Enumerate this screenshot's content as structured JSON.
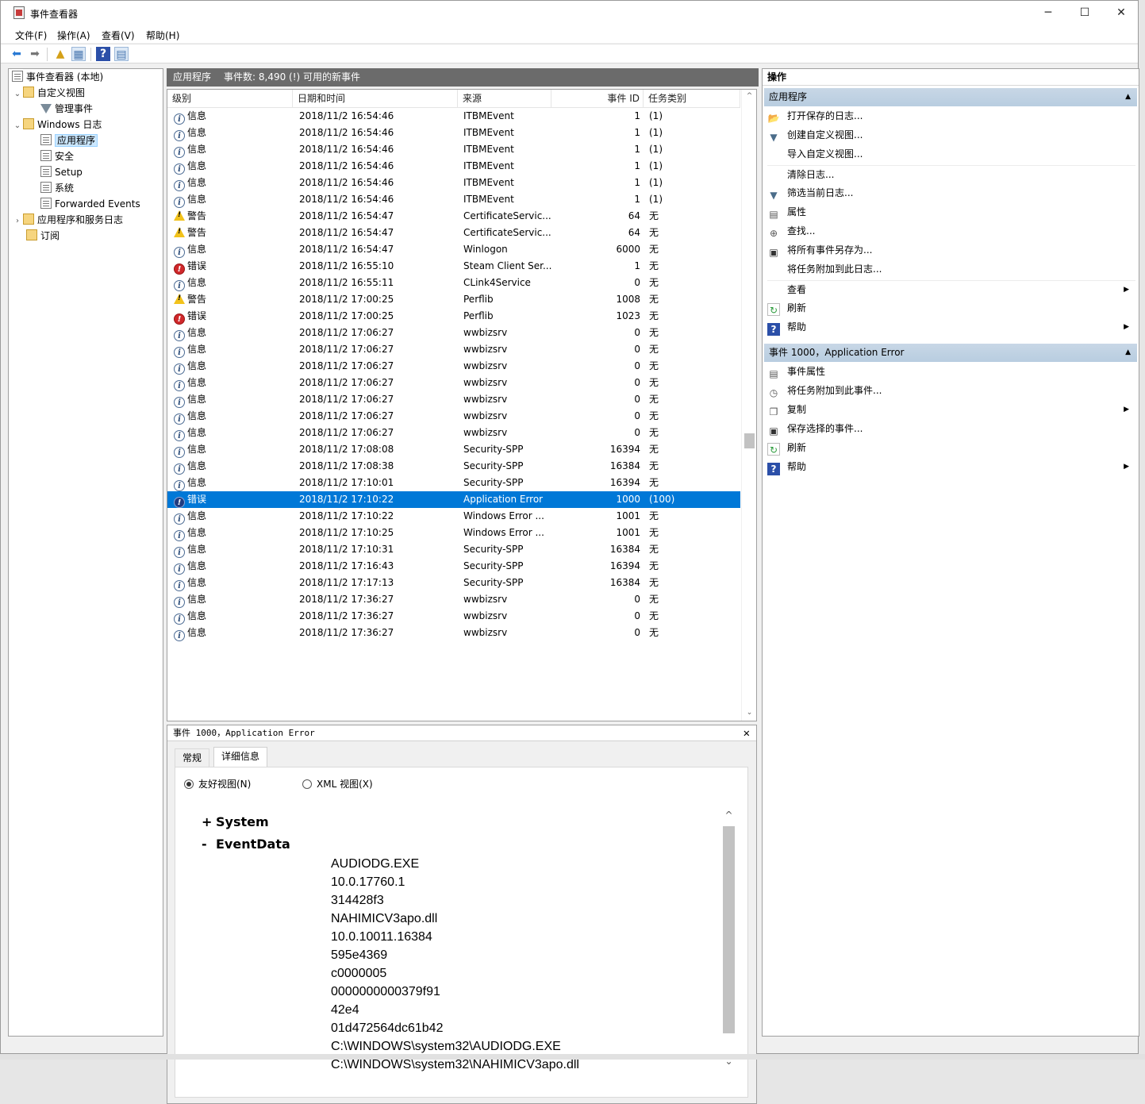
{
  "window": {
    "title": "事件查看器",
    "minimize": "─",
    "maximize": "☐",
    "close": "✕"
  },
  "menu": [
    "文件(F)",
    "操作(A)",
    "查看(V)",
    "帮助(H)"
  ],
  "tree": {
    "root": "事件查看器 (本地)",
    "custom_views": "自定义视图",
    "admin_events": "管理事件",
    "windows_logs": "Windows 日志",
    "application": "应用程序",
    "security": "安全",
    "setup": "Setup",
    "system": "系统",
    "forwarded": "Forwarded Events",
    "apps_services": "应用程序和服务日志",
    "subscriptions": "订阅"
  },
  "center": {
    "header_title": "应用程序",
    "header_count": "事件数: 8,490 (!) 可用的新事件",
    "columns": [
      "级别",
      "日期和时间",
      "来源",
      "事件 ID",
      "任务类别"
    ],
    "events": [
      {
        "lvl": "info",
        "level": "信息",
        "dt": "2018/11/2 16:54:46",
        "src": "ITBMEvent",
        "id": "1",
        "task": "(1)"
      },
      {
        "lvl": "info",
        "level": "信息",
        "dt": "2018/11/2 16:54:46",
        "src": "ITBMEvent",
        "id": "1",
        "task": "(1)"
      },
      {
        "lvl": "info",
        "level": "信息",
        "dt": "2018/11/2 16:54:46",
        "src": "ITBMEvent",
        "id": "1",
        "task": "(1)"
      },
      {
        "lvl": "info",
        "level": "信息",
        "dt": "2018/11/2 16:54:46",
        "src": "ITBMEvent",
        "id": "1",
        "task": "(1)"
      },
      {
        "lvl": "info",
        "level": "信息",
        "dt": "2018/11/2 16:54:46",
        "src": "ITBMEvent",
        "id": "1",
        "task": "(1)"
      },
      {
        "lvl": "info",
        "level": "信息",
        "dt": "2018/11/2 16:54:46",
        "src": "ITBMEvent",
        "id": "1",
        "task": "(1)"
      },
      {
        "lvl": "warn",
        "level": "警告",
        "dt": "2018/11/2 16:54:47",
        "src": "CertificateServic...",
        "id": "64",
        "task": "无"
      },
      {
        "lvl": "warn",
        "level": "警告",
        "dt": "2018/11/2 16:54:47",
        "src": "CertificateServic...",
        "id": "64",
        "task": "无"
      },
      {
        "lvl": "info",
        "level": "信息",
        "dt": "2018/11/2 16:54:47",
        "src": "Winlogon",
        "id": "6000",
        "task": "无"
      },
      {
        "lvl": "err",
        "level": "错误",
        "dt": "2018/11/2 16:55:10",
        "src": "Steam Client Ser...",
        "id": "1",
        "task": "无"
      },
      {
        "lvl": "info",
        "level": "信息",
        "dt": "2018/11/2 16:55:11",
        "src": "CLink4Service",
        "id": "0",
        "task": "无"
      },
      {
        "lvl": "warn",
        "level": "警告",
        "dt": "2018/11/2 17:00:25",
        "src": "Perflib",
        "id": "1008",
        "task": "无"
      },
      {
        "lvl": "err",
        "level": "错误",
        "dt": "2018/11/2 17:00:25",
        "src": "Perflib",
        "id": "1023",
        "task": "无"
      },
      {
        "lvl": "info",
        "level": "信息",
        "dt": "2018/11/2 17:06:27",
        "src": "wwbizsrv",
        "id": "0",
        "task": "无"
      },
      {
        "lvl": "info",
        "level": "信息",
        "dt": "2018/11/2 17:06:27",
        "src": "wwbizsrv",
        "id": "0",
        "task": "无"
      },
      {
        "lvl": "info",
        "level": "信息",
        "dt": "2018/11/2 17:06:27",
        "src": "wwbizsrv",
        "id": "0",
        "task": "无"
      },
      {
        "lvl": "info",
        "level": "信息",
        "dt": "2018/11/2 17:06:27",
        "src": "wwbizsrv",
        "id": "0",
        "task": "无"
      },
      {
        "lvl": "info",
        "level": "信息",
        "dt": "2018/11/2 17:06:27",
        "src": "wwbizsrv",
        "id": "0",
        "task": "无"
      },
      {
        "lvl": "info",
        "level": "信息",
        "dt": "2018/11/2 17:06:27",
        "src": "wwbizsrv",
        "id": "0",
        "task": "无"
      },
      {
        "lvl": "info",
        "level": "信息",
        "dt": "2018/11/2 17:06:27",
        "src": "wwbizsrv",
        "id": "0",
        "task": "无"
      },
      {
        "lvl": "info",
        "level": "信息",
        "dt": "2018/11/2 17:08:08",
        "src": "Security-SPP",
        "id": "16394",
        "task": "无"
      },
      {
        "lvl": "info",
        "level": "信息",
        "dt": "2018/11/2 17:08:38",
        "src": "Security-SPP",
        "id": "16384",
        "task": "无"
      },
      {
        "lvl": "info",
        "level": "信息",
        "dt": "2018/11/2 17:10:01",
        "src": "Security-SPP",
        "id": "16394",
        "task": "无"
      },
      {
        "lvl": "err",
        "level": "错误",
        "dt": "2018/11/2 17:10:22",
        "src": "Application Error",
        "id": "1000",
        "task": "(100)",
        "selected": true
      },
      {
        "lvl": "info",
        "level": "信息",
        "dt": "2018/11/2 17:10:22",
        "src": "Windows Error ...",
        "id": "1001",
        "task": "无"
      },
      {
        "lvl": "info",
        "level": "信息",
        "dt": "2018/11/2 17:10:25",
        "src": "Windows Error ...",
        "id": "1001",
        "task": "无"
      },
      {
        "lvl": "info",
        "level": "信息",
        "dt": "2018/11/2 17:10:31",
        "src": "Security-SPP",
        "id": "16384",
        "task": "无"
      },
      {
        "lvl": "info",
        "level": "信息",
        "dt": "2018/11/2 17:16:43",
        "src": "Security-SPP",
        "id": "16394",
        "task": "无"
      },
      {
        "lvl": "info",
        "level": "信息",
        "dt": "2018/11/2 17:17:13",
        "src": "Security-SPP",
        "id": "16384",
        "task": "无"
      },
      {
        "lvl": "info",
        "level": "信息",
        "dt": "2018/11/2 17:36:27",
        "src": "wwbizsrv",
        "id": "0",
        "task": "无"
      },
      {
        "lvl": "info",
        "level": "信息",
        "dt": "2018/11/2 17:36:27",
        "src": "wwbizsrv",
        "id": "0",
        "task": "无"
      },
      {
        "lvl": "info",
        "level": "信息",
        "dt": "2018/11/2 17:36:27",
        "src": "wwbizsrv",
        "id": "0",
        "task": "无"
      }
    ]
  },
  "detail": {
    "title": "事件 1000，Application Error",
    "close": "✕",
    "tabs": [
      "常规",
      "详细信息"
    ],
    "active_tab": "详细信息",
    "radio_friendly": "友好视图(N)",
    "radio_xml": "XML 视图(X)",
    "section_system": "System",
    "section_eventdata": "EventData",
    "system_toggle": "+",
    "eventdata_toggle": "-",
    "eventdata": [
      "AUDIODG.EXE",
      "10.0.17760.1",
      "314428f3",
      "NAHIMICV3apo.dll",
      "10.0.10011.16384",
      "595e4369",
      "c0000005",
      "0000000000379f91",
      "42e4",
      "01d472564dc61b42",
      "C:\\WINDOWS\\system32\\AUDIODG.EXE",
      "C:\\WINDOWS\\system32\\NAHIMICV3apo.dll"
    ]
  },
  "actions": {
    "title": "操作",
    "section1": "应用程序",
    "section1_items": [
      {
        "icon": "open-folder-icon",
        "glyph": "📂",
        "label": "打开保存的日志..."
      },
      {
        "icon": "filter-icon",
        "glyph": "▼",
        "label": "创建自定义视图..."
      },
      {
        "icon": "blank",
        "glyph": "",
        "label": "导入自定义视图..."
      },
      {
        "icon": "blank",
        "glyph": "",
        "label": "清除日志..."
      },
      {
        "icon": "filter-icon",
        "glyph": "▼",
        "label": "筛选当前日志..."
      },
      {
        "icon": "properties-icon",
        "glyph": "▤",
        "label": "属性"
      },
      {
        "icon": "binoculars-icon",
        "glyph": "⊕",
        "label": "查找..."
      },
      {
        "icon": "save-icon",
        "glyph": "▣",
        "label": "将所有事件另存为..."
      },
      {
        "icon": "blank",
        "glyph": "",
        "label": "将任务附加到此日志..."
      },
      {
        "icon": "blank",
        "glyph": "",
        "label": "查看",
        "sub": true
      },
      {
        "icon": "refresh-icon",
        "glyph": "↻",
        "label": "刷新"
      },
      {
        "icon": "help-icon",
        "glyph": "?",
        "label": "帮助",
        "sub": true
      }
    ],
    "section2": "事件 1000，Application Error",
    "section2_items": [
      {
        "icon": "properties-icon",
        "glyph": "▤",
        "label": "事件属性"
      },
      {
        "icon": "task-icon",
        "glyph": "◷",
        "label": "将任务附加到此事件..."
      },
      {
        "icon": "copy-icon",
        "glyph": "❐",
        "label": "复制",
        "sub": true
      },
      {
        "icon": "save-icon",
        "glyph": "▣",
        "label": "保存选择的事件..."
      },
      {
        "icon": "refresh-icon",
        "glyph": "↻",
        "label": "刷新"
      },
      {
        "icon": "help-icon",
        "glyph": "?",
        "label": "帮助",
        "sub": true
      }
    ]
  }
}
